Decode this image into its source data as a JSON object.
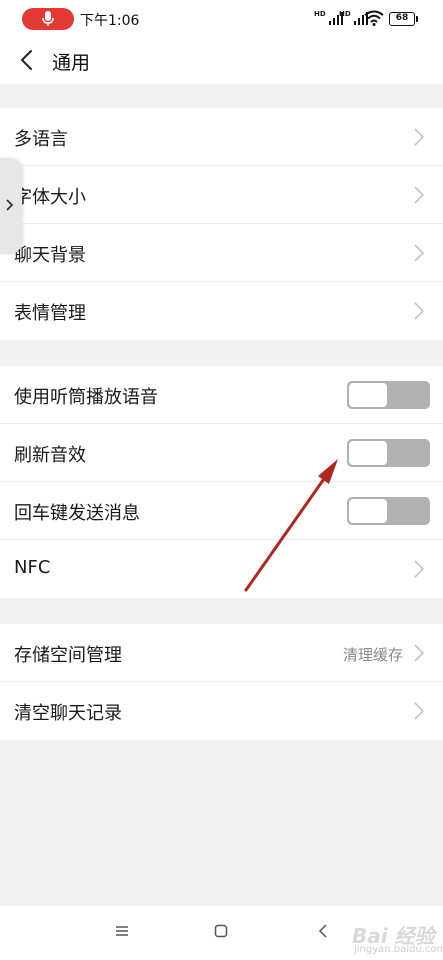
{
  "status_bar": {
    "time": "下午1:06",
    "network_1": "HD",
    "network_2": "HD",
    "battery": "68"
  },
  "header": {
    "title": "通用",
    "back_icon": "chevron-left-icon"
  },
  "groups": [
    {
      "items": [
        {
          "label": "多语言",
          "control": "chevron"
        },
        {
          "label": "字体大小",
          "control": "chevron"
        },
        {
          "label": "聊天背景",
          "control": "chevron"
        },
        {
          "label": "表情管理",
          "control": "chevron"
        }
      ]
    },
    {
      "items": [
        {
          "label": "使用听筒播放语音",
          "control": "toggle",
          "enabled": false
        },
        {
          "label": "刷新音效",
          "control": "toggle",
          "enabled": false
        },
        {
          "label": "回车键发送消息",
          "control": "toggle",
          "enabled": false
        },
        {
          "label": "NFC",
          "control": "chevron"
        }
      ]
    },
    {
      "items": [
        {
          "label": "存储空间管理",
          "hint": "清理缓存",
          "control": "chevron"
        },
        {
          "label": "清空聊天记录",
          "control": "chevron"
        }
      ]
    }
  ],
  "watermark": {
    "text": "Bai 经验",
    "subtext": "jingyan.baidu.com"
  },
  "colors": {
    "background": "#f2f2f2",
    "row": "#ffffff",
    "toggle_off": "#b1b1b1",
    "mic": "#e53935",
    "arrow": "#b3261e"
  }
}
